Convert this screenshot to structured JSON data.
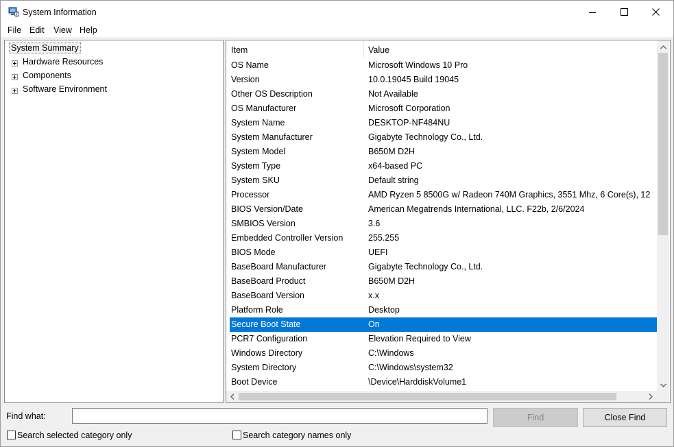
{
  "window": {
    "title": "System Information",
    "app_icon": "system-information-icon",
    "controls": [
      "minimize-icon",
      "maximize-icon",
      "close-icon"
    ]
  },
  "menu": {
    "items": [
      "File",
      "Edit",
      "View",
      "Help"
    ]
  },
  "tree": {
    "root": "System Summary",
    "children": [
      "Hardware Resources",
      "Components",
      "Software Environment"
    ]
  },
  "list": {
    "headers": {
      "item": "Item",
      "value": "Value"
    },
    "selected_index": 18,
    "rows": [
      {
        "item": "OS Name",
        "value": "Microsoft Windows 10 Pro"
      },
      {
        "item": "Version",
        "value": "10.0.19045 Build 19045"
      },
      {
        "item": "Other OS Description",
        "value": "Not Available"
      },
      {
        "item": "OS Manufacturer",
        "value": "Microsoft Corporation"
      },
      {
        "item": "System Name",
        "value": "DESKTOP-NF484NU"
      },
      {
        "item": "System Manufacturer",
        "value": "Gigabyte Technology Co., Ltd."
      },
      {
        "item": "System Model",
        "value": "B650M D2H"
      },
      {
        "item": "System Type",
        "value": "x64-based PC"
      },
      {
        "item": "System SKU",
        "value": "Default string"
      },
      {
        "item": "Processor",
        "value": "AMD Ryzen 5 8500G w/ Radeon 740M Graphics, 3551 Mhz, 6 Core(s), 12"
      },
      {
        "item": "BIOS Version/Date",
        "value": "American Megatrends International, LLC. F22b, 2/6/2024"
      },
      {
        "item": "SMBIOS Version",
        "value": "3.6"
      },
      {
        "item": "Embedded Controller Version",
        "value": "255.255"
      },
      {
        "item": "BIOS Mode",
        "value": "UEFI"
      },
      {
        "item": "BaseBoard Manufacturer",
        "value": "Gigabyte Technology Co., Ltd."
      },
      {
        "item": "BaseBoard Product",
        "value": "B650M D2H"
      },
      {
        "item": "BaseBoard Version",
        "value": "x.x"
      },
      {
        "item": "Platform Role",
        "value": "Desktop"
      },
      {
        "item": "Secure Boot State",
        "value": "On"
      },
      {
        "item": "PCR7 Configuration",
        "value": "Elevation Required to View"
      },
      {
        "item": "Windows Directory",
        "value": "C:\\Windows"
      },
      {
        "item": "System Directory",
        "value": "C:\\Windows\\system32"
      },
      {
        "item": "Boot Device",
        "value": "\\Device\\HarddiskVolume1"
      }
    ]
  },
  "find": {
    "label": "Find what:",
    "value": "",
    "find_button": "Find",
    "close_find_button": "Close Find",
    "search_selected_label": "Search selected category only",
    "search_selected_checked": false,
    "search_names_label": "Search category names only",
    "search_names_checked": false
  },
  "colors": {
    "selection": "#0078d7",
    "background": "#f0f0f0"
  }
}
